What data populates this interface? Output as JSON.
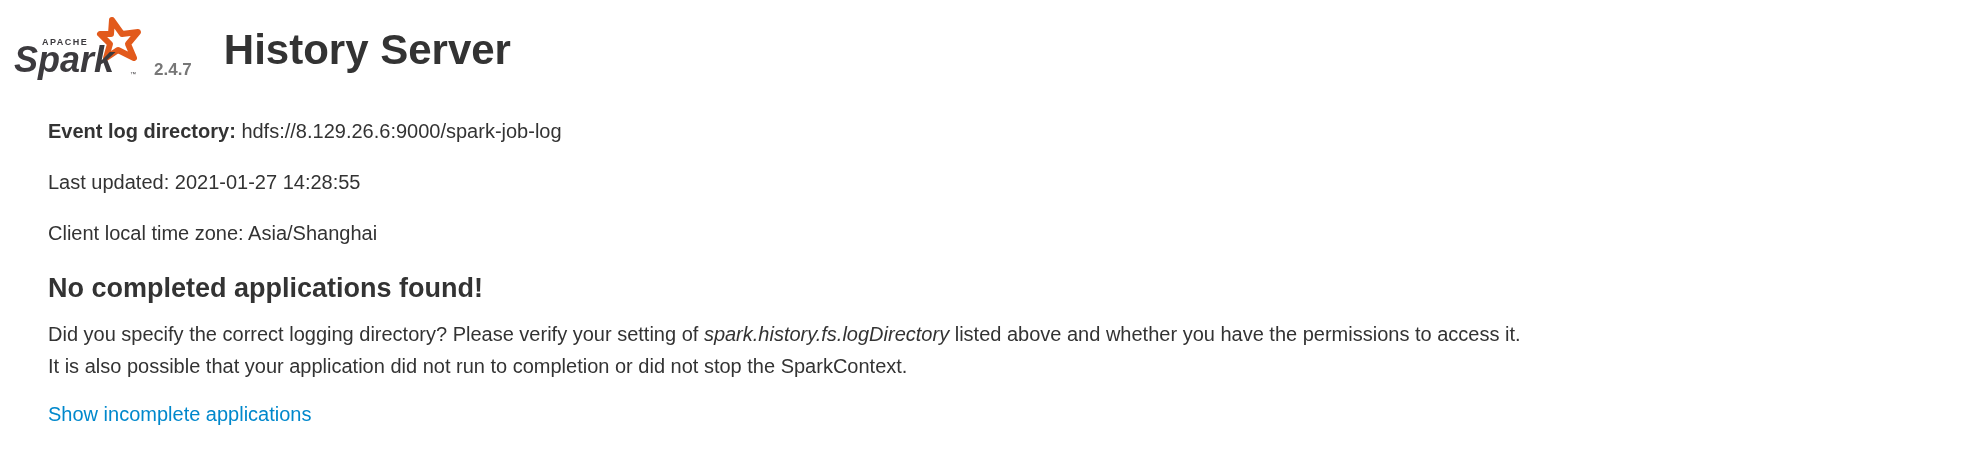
{
  "header": {
    "logo": {
      "brand": "APACHE",
      "wordmark": "Spark",
      "trademark": "™"
    },
    "version": "2.4.7",
    "title": "History Server"
  },
  "info": [
    {
      "label": "Event log directory:",
      "value": "hdfs://8.129.26.6:9000/spark-job-log"
    },
    {
      "value": "Last updated: 2021-01-27 14:28:55"
    },
    {
      "value": "Client local time zone: Asia/Shanghai"
    }
  ],
  "message": {
    "heading": "No completed applications found!",
    "lines": [
      "Did you specify the correct logging directory? Please verify your setting of *spark.history.fs.logDirectory* listed above and whether you have the permissions to access it.",
      "It is also possible that your application did not run to completion or did not stop the SparkContext."
    ]
  },
  "link": "Show incomplete applications"
}
